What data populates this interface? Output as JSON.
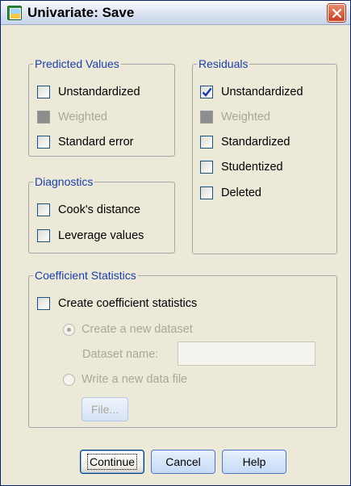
{
  "window": {
    "title": "Univariate: Save"
  },
  "predicted": {
    "legend": "Predicted Values",
    "items": [
      {
        "label": "Unstandardized",
        "checked": false,
        "disabled": false
      },
      {
        "label": "Weighted",
        "checked": false,
        "disabled": true
      },
      {
        "label": "Standard error",
        "checked": false,
        "disabled": false
      }
    ]
  },
  "residuals": {
    "legend": "Residuals",
    "items": [
      {
        "label": "Unstandardized",
        "checked": true,
        "disabled": false
      },
      {
        "label": "Weighted",
        "checked": false,
        "disabled": true
      },
      {
        "label": "Standardized",
        "checked": false,
        "disabled": false
      },
      {
        "label": "Studentized",
        "checked": false,
        "disabled": false
      },
      {
        "label": "Deleted",
        "checked": false,
        "disabled": false
      }
    ]
  },
  "diagnostics": {
    "legend": "Diagnostics",
    "items": [
      {
        "label": "Cook's distance",
        "checked": false
      },
      {
        "label": "Leverage values",
        "checked": false
      }
    ]
  },
  "coefficient": {
    "legend": "Coefficient Statistics",
    "create_label": "Create coefficient statistics",
    "new_dataset_label": "Create a new dataset",
    "dataset_name_label": "Dataset name:",
    "dataset_name_value": "",
    "write_file_label": "Write a new data file",
    "file_button": "File..."
  },
  "buttons": {
    "continue": "Continue",
    "cancel": "Cancel",
    "help": "Help"
  },
  "colors": {
    "legend_text": "#1a3fa8",
    "dialog_bg": "#ece9d8",
    "disabled_text": "#a9a79a"
  }
}
